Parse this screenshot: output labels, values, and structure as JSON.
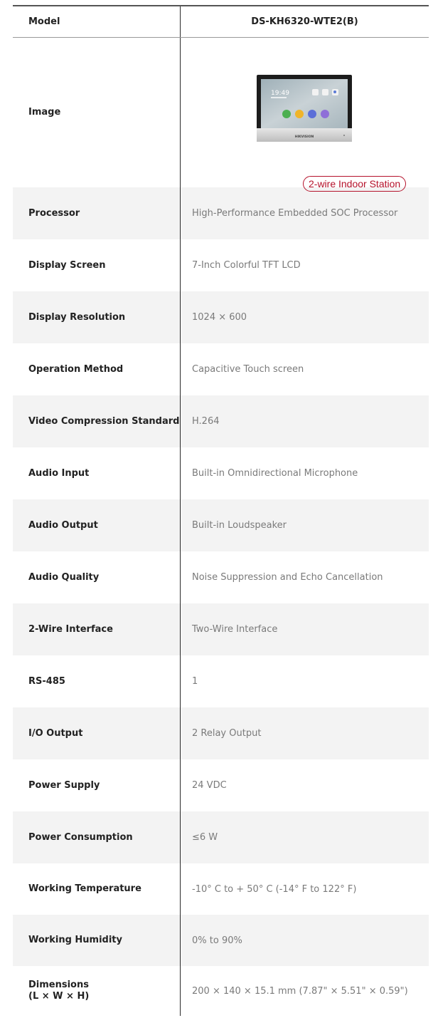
{
  "header": {
    "label": "Model",
    "value": "DS-KH6320-WTE2(B)"
  },
  "image_row": {
    "label": "Image",
    "badge": "2-wire Indoor Station",
    "device_screen": {
      "time": "19:49",
      "brand": "HIKVISION"
    }
  },
  "specs": [
    {
      "label": "Processor",
      "value": "High-Performance Embedded SOC Processor"
    },
    {
      "label": "Display Screen",
      "value": "7-Inch Colorful TFT LCD"
    },
    {
      "label": "Display Resolution",
      "value": "1024 × 600"
    },
    {
      "label": "Operation Method",
      "value": "Capacitive Touch screen"
    },
    {
      "label": "Video Compression Standard",
      "value": "H.264"
    },
    {
      "label": "Audio Input",
      "value": "Built-in Omnidirectional Microphone"
    },
    {
      "label": "Audio Output",
      "value": "Built-in Loudspeaker"
    },
    {
      "label": "Audio Quality",
      "value": "Noise Suppression and Echo Cancellation"
    },
    {
      "label": "2-Wire Interface",
      "value": "Two-Wire Interface"
    },
    {
      "label": "RS-485",
      "value": "1"
    },
    {
      "label": "I/O Output",
      "value": "2 Relay Output"
    },
    {
      "label": "Power Supply",
      "value": "24 VDC"
    },
    {
      "label": "Power Consumption",
      "value": "≤6 W"
    },
    {
      "label": "Working Temperature",
      "value": "-10° C to + 50° C (-14° F to 122° F)"
    },
    {
      "label": "Working Humidity",
      "value": "0% to 90%"
    },
    {
      "label": "Dimensions",
      "label2": "(L × W × H)",
      "value": "200 × 140 × 15.1 mm (7.87\" × 5.51\" × 0.59\")"
    }
  ]
}
